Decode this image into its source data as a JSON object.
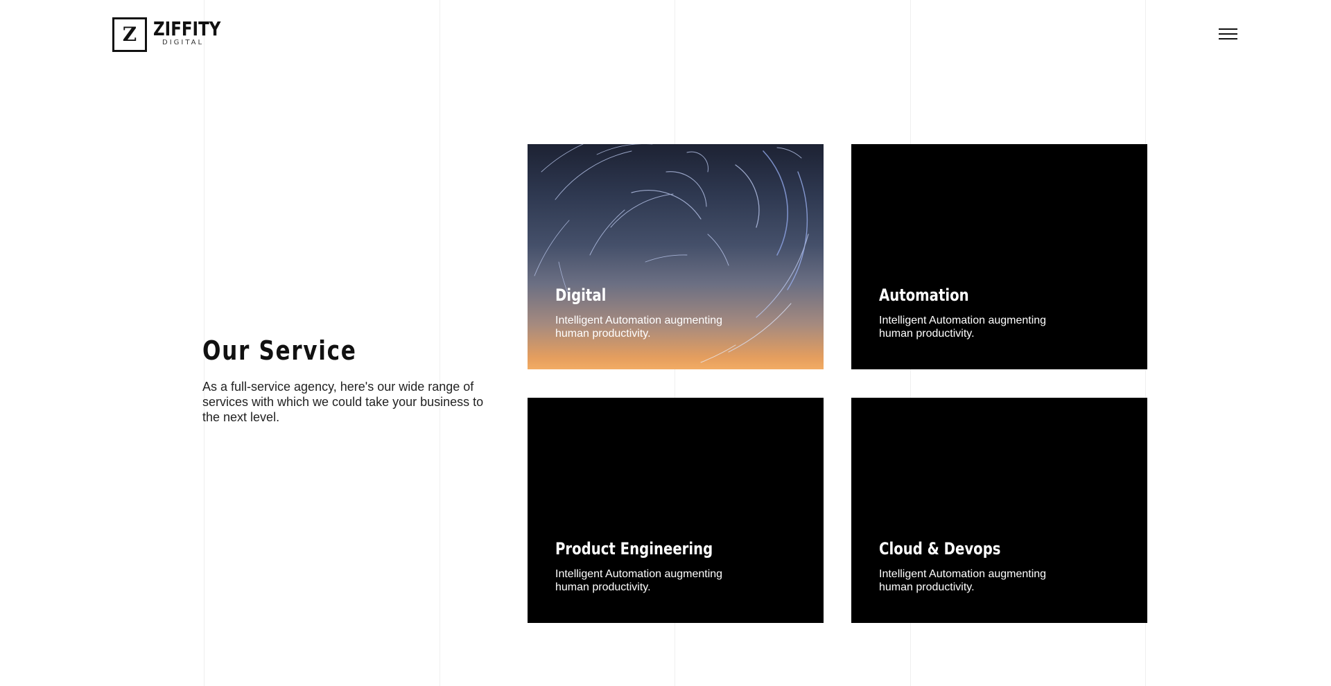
{
  "brand": {
    "mark": "Z",
    "name": "ZIFFITY",
    "sub": "DIGITAL"
  },
  "header": {
    "menu_icon": "hamburger-menu-icon"
  },
  "intro": {
    "title": "Our Service",
    "text": "As a full-service agency, here's our wide range of services with which we could take your business to the next level."
  },
  "services": [
    {
      "title": "Digital",
      "description": "Intelligent Automation augmenting human productivity.",
      "background": "star-trails-image"
    },
    {
      "title": "Automation",
      "description": "Intelligent Automation augmenting human productivity.",
      "background": "#000000"
    },
    {
      "title": "Product Engineering",
      "description": "Intelligent Automation augmenting human productivity.",
      "background": "#000000"
    },
    {
      "title": "Cloud & Devops",
      "description": "Intelligent Automation augmenting human productivity.",
      "background": "#000000"
    }
  ],
  "colors": {
    "text": "#111111",
    "card": "#000000",
    "grid_line": "#efefef"
  }
}
